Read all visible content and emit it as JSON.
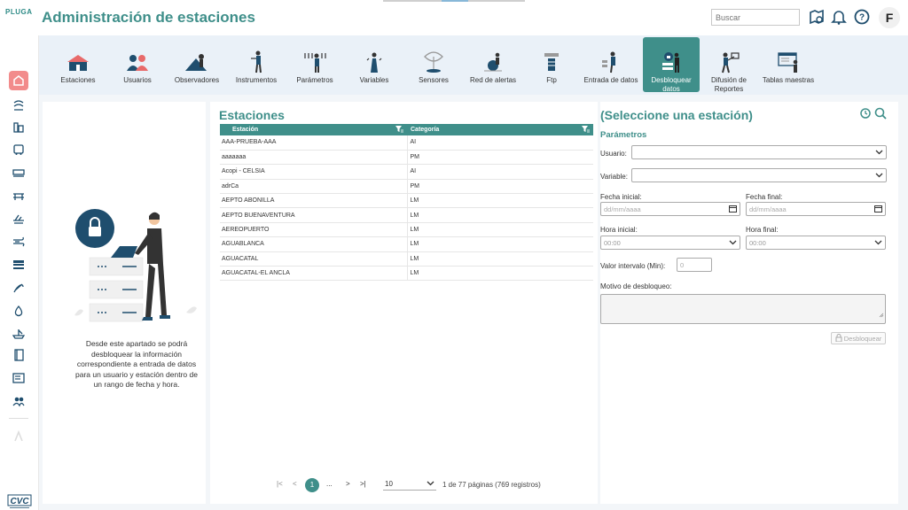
{
  "header": {
    "logo": "PLUGA",
    "title": "Administración de estaciones",
    "search_placeholder": "Buscar",
    "user_initial": "F"
  },
  "sidebar": {
    "items": [
      "active-home",
      "water",
      "buildings",
      "bus",
      "train",
      "bridge",
      "plane",
      "wind",
      "layers",
      "link",
      "drop",
      "ship",
      "book",
      "form",
      "group",
      "disabled"
    ],
    "brand": "CVC"
  },
  "nav": {
    "items": [
      {
        "label": "Estaciones",
        "icon": "stations-icon"
      },
      {
        "label": "Usuarios",
        "icon": "users-icon"
      },
      {
        "label": "Observadores",
        "icon": "observers-icon"
      },
      {
        "label": "Instrumentos",
        "icon": "instruments-icon"
      },
      {
        "label": "Parámetros",
        "icon": "parameters-icon"
      },
      {
        "label": "Variables",
        "icon": "variables-icon"
      },
      {
        "label": "Sensores",
        "icon": "sensors-icon"
      },
      {
        "label": "Red de alertas",
        "icon": "alerts-icon"
      },
      {
        "label": "Ftp",
        "icon": "ftp-icon"
      },
      {
        "label": "Entrada de datos",
        "icon": "data-entry-icon"
      },
      {
        "label": "Desbloquear datos",
        "icon": "unlock-data-icon",
        "active": true
      },
      {
        "label": "Difusión de Reportes",
        "icon": "reports-icon"
      },
      {
        "label": "Tablas maestras",
        "icon": "master-tables-icon"
      }
    ]
  },
  "left_panel": {
    "description": "Desde este apartado se podrá desbloquear la información correspondiente a entrada de datos para un usuario y estación dentro de un rango de fecha y hora."
  },
  "stations": {
    "title": "Estaciones",
    "columns": [
      "Estación",
      "Categoría"
    ],
    "rows": [
      [
        "AAA-PRUEBA-AAA",
        "AI"
      ],
      [
        "aaaaaaa",
        "PM"
      ],
      [
        "Acopi - CELSIA",
        "AI"
      ],
      [
        "adrCa",
        "PM"
      ],
      [
        "AEPTO ABONILLA",
        "LM"
      ],
      [
        "AEPTO BUENAVENTURA",
        "LM"
      ],
      [
        "AEREOPUERTO",
        "LM"
      ],
      [
        "AGUABLANCA",
        "LM"
      ],
      [
        "AGUACATAL",
        "LM"
      ],
      [
        "AGUACATAL-EL ANCLA",
        "LM"
      ]
    ],
    "pager": {
      "first": "|<",
      "prev": "<",
      "current": "1",
      "ellipsis": "...",
      "next": ">",
      "last": ">|",
      "page_size": "10",
      "info": "1 de 77 páginas (769 registros)"
    }
  },
  "form": {
    "title": "(Seleccione una estación)",
    "section": "Parámetros",
    "usuario_label": "Usuario:",
    "variable_label": "Variable:",
    "fecha_inicial_label": "Fecha inicial:",
    "fecha_final_label": "Fecha final:",
    "date_placeholder": "dd/mm/aaaa",
    "hora_inicial_label": "Hora inicial:",
    "hora_final_label": "Hora final:",
    "time_value": "00:00",
    "intervalo_label": "Valor intervalo (Min):",
    "intervalo_value": "0",
    "motivo_label": "Motivo de desbloqueo:",
    "unlock_button": "Desbloquear"
  },
  "colors": {
    "accent": "#3f8f8a",
    "nav_bg": "#eaf1f8",
    "sidebar_active": "#f28b8b",
    "lock_circle": "#1f4e6e"
  }
}
